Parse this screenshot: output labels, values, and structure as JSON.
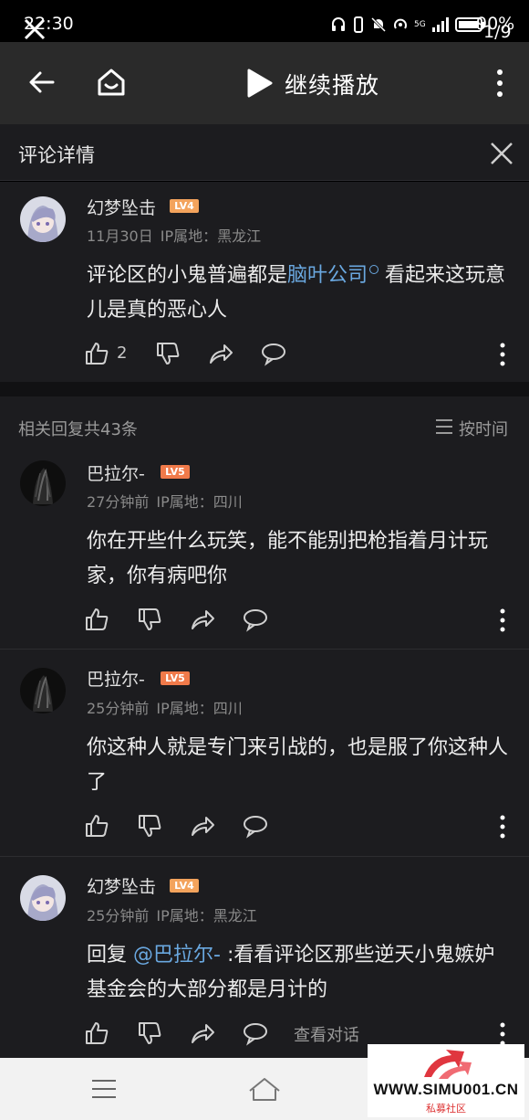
{
  "status_bar": {
    "time": "22:30",
    "battery": "90%",
    "counter": "1/9",
    "signal_label": "5G"
  },
  "nav": {
    "title": "继续播放"
  },
  "detail": {
    "title": "评论详情"
  },
  "main_comment": {
    "username": "幻梦坠击",
    "level": "LV4",
    "date": "11月30日",
    "ip": "IP属地：黑龙江",
    "text_before": "评论区的小鬼普遍都是",
    "link": "脑叶公司",
    "text_after": " 看起来这玩意儿是真的恶心人",
    "likes": "2"
  },
  "replies_header": {
    "count_label": "相关回复共43条",
    "sort_label": "按时间"
  },
  "replies": [
    {
      "username": "巴拉尔-",
      "level": "LV5",
      "time": "27分钟前",
      "ip": "IP属地：四川",
      "text": "你在开些什么玩笑，能不能别把枪指着月计玩家，你有病吧你"
    },
    {
      "username": "巴拉尔-",
      "level": "LV5",
      "time": "25分钟前",
      "ip": "IP属地：四川",
      "text": "你这种人就是专门来引战的，也是服了你这种人了"
    },
    {
      "username": "幻梦坠击",
      "level": "LV4",
      "time": "25分钟前",
      "ip": "IP属地：黑龙江",
      "reply_prefix": "回复 ",
      "mention": "@巴拉尔-",
      "text": " :看看评论区那些逆天小鬼嫉妒基金会的大部分都是月计的",
      "view_conversation": "查看对话"
    }
  ],
  "watermark": {
    "site": "WWW.SIMU001.CN",
    "sub": "私募社区"
  },
  "colors": {
    "background": "#1c1c1f",
    "nav": "#2a2a2a",
    "link": "#6aa8e0",
    "lv4": "#f3a35c",
    "lv5": "#f07a4a"
  }
}
